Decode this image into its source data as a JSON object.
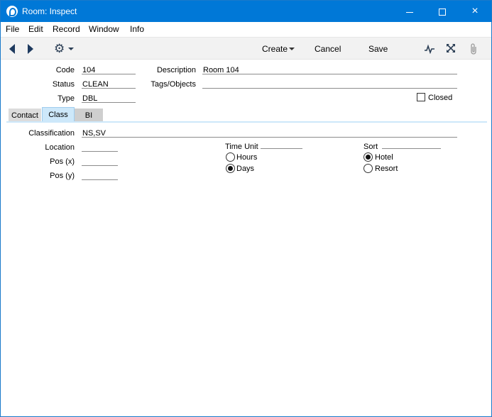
{
  "window": {
    "title": "Room: Inspect",
    "controls": {
      "minimize": "minimize-icon",
      "maximize": "maximize-icon",
      "close": "×"
    }
  },
  "menu": [
    "File",
    "Edit",
    "Record",
    "Window",
    "Info"
  ],
  "toolbar": {
    "create_label": "Create",
    "cancel_label": "Cancel",
    "save_label": "Save"
  },
  "header_fields": {
    "code_label": "Code",
    "code_value": "104",
    "status_label": "Status",
    "status_value": "CLEAN",
    "type_label": "Type",
    "type_value": "DBL",
    "description_label": "Description",
    "description_value": "Room 104",
    "tags_label": "Tags/Objects",
    "tags_value": "",
    "closed_label": "Closed",
    "closed_checked": false
  },
  "tabs": [
    {
      "label": "Contact",
      "active": false
    },
    {
      "label": "Class",
      "active": true
    },
    {
      "label": "BI",
      "active": false
    }
  ],
  "class_tab": {
    "classification_label": "Classification",
    "classification_value": "NS,SV",
    "location_label": "Location",
    "location_value": "",
    "posx_label": "Pos (x)",
    "posx_value": "",
    "posy_label": "Pos (y)",
    "posy_value": "",
    "time_unit": {
      "label": "Time Unit",
      "options": [
        "Hours",
        "Days"
      ],
      "selected": "Days"
    },
    "sort": {
      "label": "Sort",
      "options": [
        "Hotel",
        "Resort"
      ],
      "selected": "Hotel"
    }
  },
  "colors": {
    "titlebar": "#0078d7",
    "active_tab": "#cde8fa"
  }
}
